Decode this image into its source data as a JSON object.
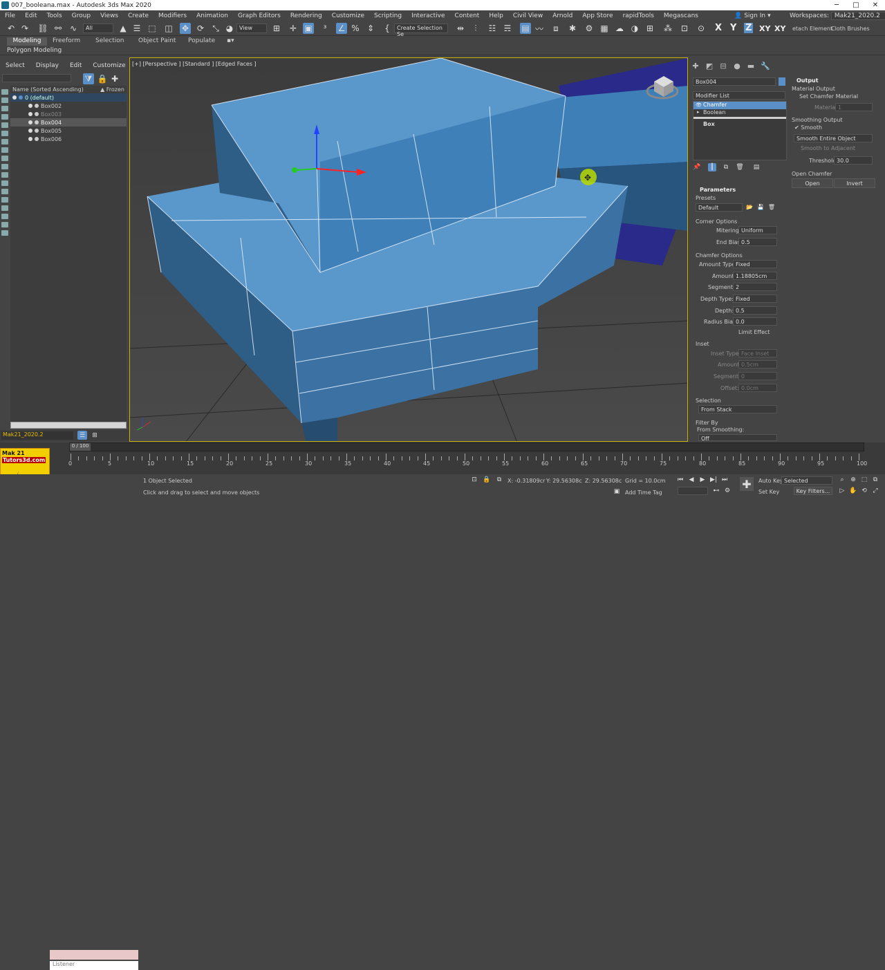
{
  "window": {
    "title": "007_booleana.max - Autodesk 3ds Max 2020",
    "min": "─",
    "max": "□",
    "close": "✕"
  },
  "menu": [
    "File",
    "Edit",
    "Tools",
    "Group",
    "Views",
    "Create",
    "Modifiers",
    "Animation",
    "Graph Editors",
    "Rendering",
    "Customize",
    "Scripting",
    "Interactive",
    "Content",
    "Help",
    "Civil View",
    "Arnold",
    "App Store",
    "rapidTools",
    "Megascans"
  ],
  "account": {
    "sign_in": "Sign In",
    "workspaces_label": "Workspaces:",
    "workspace": "Mak21_2020.2"
  },
  "toolbar": {
    "filter": "All",
    "view": "View",
    "selection_set": "Create Selection Se",
    "axes": [
      "X",
      "Y",
      "Z",
      "XY",
      "XY"
    ],
    "detach": "etach Element",
    "cloth": "Cloth Brushes"
  },
  "ribbon": {
    "tabs": [
      "Modeling",
      "Freeform",
      "Selection",
      "Object Paint",
      "Populate"
    ],
    "sub": "Polygon Modeling"
  },
  "scene_explorer": {
    "menu": [
      "Select",
      "Display",
      "Edit",
      "Customize"
    ],
    "column_name": "Name (Sorted Ascending)",
    "column_frozen": "▲ Frozen",
    "items": [
      {
        "label": "0 (default)",
        "state": "blue"
      },
      {
        "label": "Box002",
        "state": "normal"
      },
      {
        "label": "Box003",
        "state": "dim"
      },
      {
        "label": "Box004",
        "state": "sel"
      },
      {
        "label": "Box005",
        "state": "normal"
      },
      {
        "label": "Box006",
        "state": "normal"
      }
    ],
    "layer": "Mak21_2020.2"
  },
  "viewport": {
    "label": "[+] [Perspective ] [Standard ] [Edged Faces ]"
  },
  "command_panel": {
    "object_name": "Box004",
    "modifier_list": "Modifier List",
    "stack": [
      "Chamfer",
      "Boolean",
      "Box"
    ],
    "parameters": "Parameters",
    "presets": "Presets",
    "preset_value": "Default",
    "corner_options": "Corner Options",
    "mitering_label": "Mitering:",
    "mitering": "Uniform",
    "end_bias_label": "End Bias:",
    "end_bias": "0.5",
    "chamfer_options": "Chamfer Options",
    "amount_type_label": "Amount Type:",
    "amount_type": "Fixed",
    "amount_label": "Amount:",
    "amount": "1.18805cm",
    "segments_label": "Segments:",
    "segments": "2",
    "depth_type_label": "Depth Type:",
    "depth_type": "Fixed",
    "depth_label": "Depth:",
    "depth": "0.5",
    "radius_bias_label": "Radius Bias:",
    "radius_bias": "0.0",
    "limit_effect": "Limit Effect",
    "inset": "Inset",
    "inset_type_label": "Inset Type:",
    "inset_type": "Face Inset",
    "inset_amount_label": "Amount:",
    "inset_amount": "0.5cm",
    "inset_segments_label": "Segments:",
    "inset_segments": "0",
    "inset_offset_label": "Offset:",
    "inset_offset": "0.0cm",
    "selection": "Selection",
    "selection_value": "From Stack",
    "filter_by": "Filter By",
    "from_smoothing": "From Smoothing:",
    "smoothing_value": "Off"
  },
  "output": {
    "title": "Output",
    "material_output": "Material Output",
    "set_chamfer_material": "Set Chamfer Material",
    "material_id_label": "Material ID:",
    "material_id": "1",
    "smoothing_output": "Smoothing Output",
    "smooth": "Smooth",
    "smooth_mode": "Smooth Entire Object",
    "smooth_adjacent": "Smooth to Adjacent",
    "threshold_label": "Threshold:",
    "threshold": "30.0",
    "open_chamfer": "Open Chamfer",
    "open_btn": "Open",
    "invert_btn": "Invert"
  },
  "timeline": {
    "frame_display": "0 / 100",
    "ticks": [
      "0",
      "5",
      "10",
      "15",
      "20",
      "25",
      "30",
      "35",
      "40",
      "45",
      "50",
      "55",
      "60",
      "65",
      "70",
      "75",
      "80",
      "85",
      "90",
      "95",
      "100"
    ]
  },
  "status": {
    "selected": "1 Object Selected",
    "hint": "Click and drag to select and move objects",
    "listener": "Listener",
    "x": "X: -0.31809cr",
    "y": "Y: 29.56308c",
    "z": "Z: 29.56308c",
    "grid": "Grid = 10.0cm",
    "add_time_tag": "Add Time Tag",
    "auto_key": "Auto Key",
    "set_key": "Set Key",
    "key_mode": "Selected",
    "key_filters": "Key Filters..."
  },
  "logo": {
    "line1": "Mak 21 Training",
    "line2": "Tutors3d.com"
  },
  "colors": {
    "accent": "#5b8fc8",
    "object_blue": "#4d8bc4",
    "selection_yellow": "#c8b000"
  }
}
